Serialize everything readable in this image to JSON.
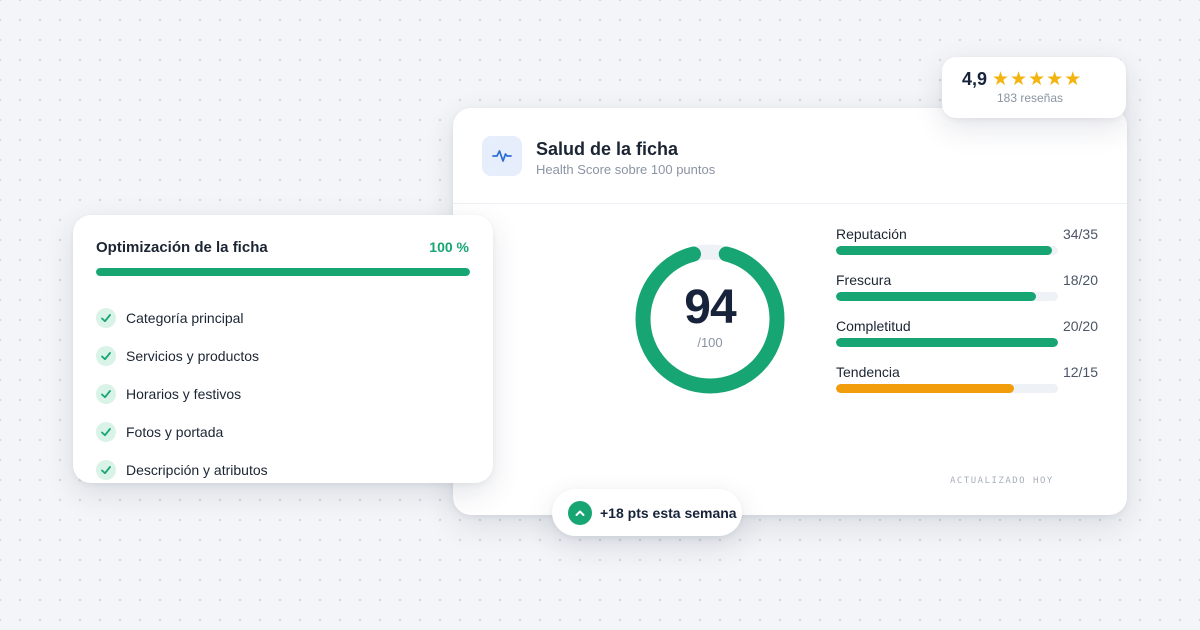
{
  "health": {
    "title": "Salud de la ficha",
    "subtitle": "Health Score sobre 100 puntos",
    "icon": "pulse-icon",
    "score": 94,
    "score_max_label": "/100",
    "score_fraction": 0.94,
    "metrics": [
      {
        "label": "Reputación",
        "value": "34/35",
        "fraction": 0.971,
        "color": "#17a673"
      },
      {
        "label": "Frescura",
        "value": "18/20",
        "fraction": 0.9,
        "color": "#17a673"
      },
      {
        "label": "Completitud",
        "value": "20/20",
        "fraction": 1.0,
        "color": "#17a673"
      },
      {
        "label": "Tendencia",
        "value": "12/15",
        "fraction": 0.8,
        "color": "#f29e0c"
      }
    ],
    "updated_label": "ACTUALIZADO HOY"
  },
  "rating": {
    "value": "4,9",
    "stars": 5,
    "count_label": "183 reseñas",
    "star_icon": "star-icon"
  },
  "optimization": {
    "title": "Optimización de la ficha",
    "percent_label": "100 %",
    "progress": 1.0,
    "items": [
      {
        "label": "Categoría principal",
        "done": true
      },
      {
        "label": "Servicios y productos",
        "done": true
      },
      {
        "label": "Horarios y festivos",
        "done": true
      },
      {
        "label": "Fotos y portada",
        "done": true
      },
      {
        "label": "Descripción y atributos",
        "done": true
      }
    ]
  },
  "trend": {
    "label": "+18 pts esta semana",
    "icon": "chevron-up-icon"
  },
  "colors": {
    "accent_green": "#17a673",
    "accent_amber": "#f29e0c",
    "star_gold": "#f4b40f",
    "gauge_gap": "#ffffff"
  }
}
